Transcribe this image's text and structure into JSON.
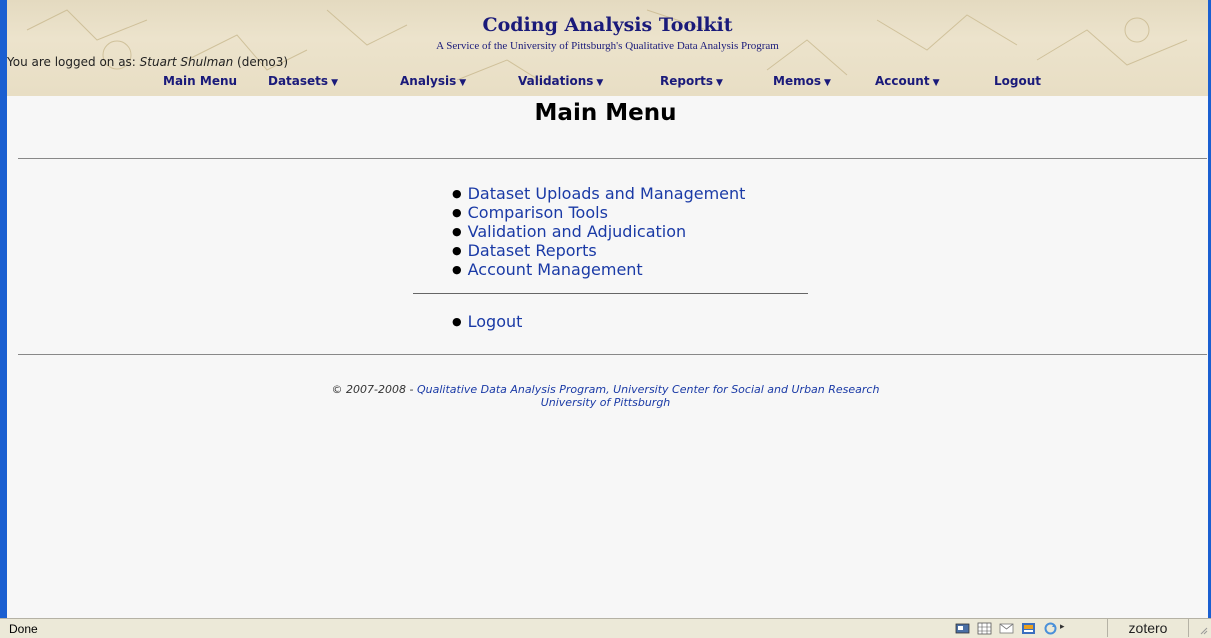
{
  "header": {
    "title": "Coding Analysis Toolkit",
    "subtitle": "A Service of the University of Pittsburgh's Qualitative Data Analysis Program",
    "logged_prefix": "You are logged on as: ",
    "user_name": "Stuart Shulman",
    "user_id": " (demo3)"
  },
  "nav": {
    "items": [
      {
        "label": "Main Menu",
        "dropdown": false
      },
      {
        "label": "Datasets",
        "dropdown": true
      },
      {
        "label": "Analysis",
        "dropdown": true
      },
      {
        "label": "Validations",
        "dropdown": true
      },
      {
        "label": "Reports",
        "dropdown": true
      },
      {
        "label": "Memos",
        "dropdown": true
      },
      {
        "label": "Account",
        "dropdown": true
      },
      {
        "label": "Logout",
        "dropdown": false
      }
    ],
    "caret": "▼"
  },
  "page": {
    "title": "Main Menu"
  },
  "menu_links": [
    "Dataset Uploads and Management",
    "Comparison Tools",
    "Validation and Adjudication",
    "Dataset Reports",
    "Account Management"
  ],
  "logout_link": "Logout",
  "footer": {
    "copyright": "© 2007-2008 - ",
    "org": "Qualitative Data Analysis Program, University Center for Social and Urban Research",
    "university": "University of Pittsburgh"
  },
  "statusbar": {
    "status": "Done",
    "zotero": "zotero"
  },
  "colors": {
    "link": "#1a3aa6",
    "header_text": "#1a1a7a",
    "frame": "#1a5fd1"
  }
}
